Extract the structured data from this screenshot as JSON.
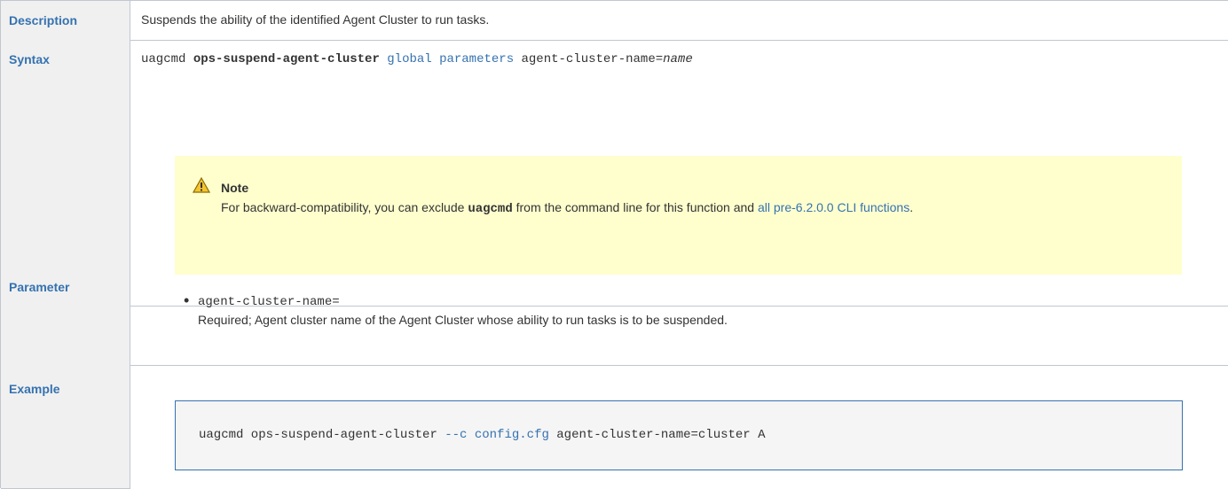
{
  "rows": {
    "description": {
      "header": "Description",
      "text": "Suspends the ability of the identified Agent Cluster to run tasks."
    },
    "syntax": {
      "header": "Syntax",
      "cmd": "uagcmd ",
      "fn": "ops-suspend-agent-cluster",
      "link": "global parameters",
      "arg": " agent-cluster-name=",
      "arg_value": "name",
      "note": {
        "title": "Note",
        "text_before": "For backward-compatibility, you can exclude ",
        "bold_code": "uagcmd",
        "text_after": " from the command line for this function and ",
        "link": "all pre-6.2.0.0 CLI functions",
        "end": "."
      }
    },
    "parameter": {
      "header": "Parameter",
      "name": "agent-cluster-name=",
      "desc": "Required; Agent cluster name of the Agent Cluster whose ability to run tasks is to be suspended."
    },
    "example": {
      "header": "Example",
      "code_before": "uagcmd ops-suspend-agent-cluster ",
      "code_link": "--c config.cfg",
      "code_after": " agent-cluster-name=cluster A"
    }
  },
  "colors": {
    "header_bg": "#f0f0f0",
    "header_text": "#3572b0",
    "link": "#3572b0",
    "note_bg": "#ffffce",
    "code_bg": "#f5f5f5",
    "border": "#c1c7d0"
  },
  "icons": {
    "note": "warning-icon",
    "bullet": "bullet-icon"
  }
}
